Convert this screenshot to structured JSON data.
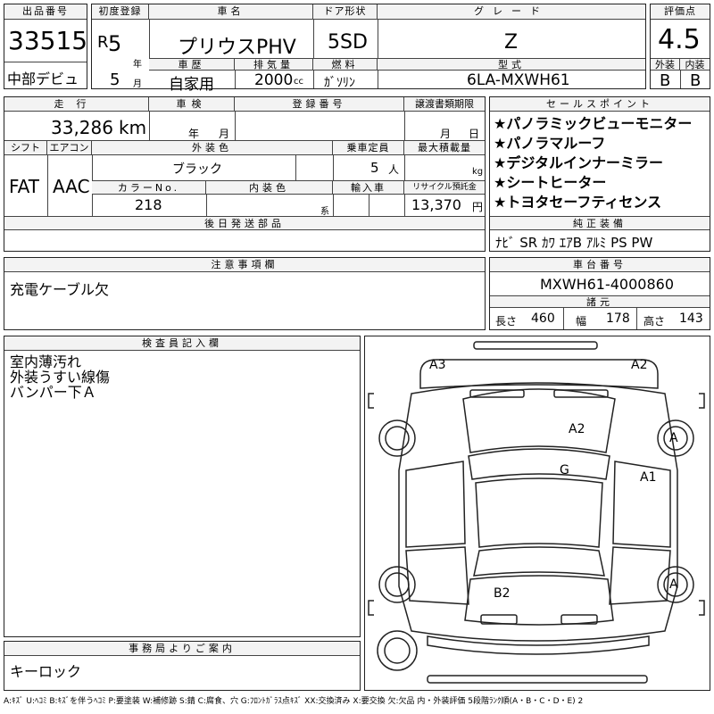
{
  "header": {
    "lot_label": "出品番号",
    "lot_number": "33515",
    "venue": "中部デビュ",
    "first_reg_label": "初度登録",
    "era": "R",
    "year_num": "5",
    "year_unit": "年",
    "month_num": "5",
    "month_unit": "月",
    "car_name_label": "車名",
    "car_name": "プリウスPHV",
    "door_label": "ドア形状",
    "door": "5SD",
    "grade_label": "グレード",
    "grade": "Z",
    "score_label": "評価点",
    "score": "4.5",
    "history_label": "車歴",
    "history": "自家用",
    "displacement_label": "排気量",
    "displacement": "2000",
    "displacement_unit": "cc",
    "fuel_label": "燃料",
    "fuel": "ｶﾞｿﾘﾝ",
    "model_label": "型式",
    "model": "6LA-MXWH61",
    "ext_label": "外装",
    "ext": "B",
    "int_label": "内装",
    "int": "B"
  },
  "row2": {
    "mileage_label": "走行",
    "mileage": "33,286",
    "mileage_unit": "km",
    "inspection_label": "車検",
    "insp_year_unit": "年",
    "insp_month_unit": "月",
    "reg_label": "登録番号",
    "transfer_label": "譲渡書類期限",
    "transfer_month": "月",
    "transfer_day": "日",
    "shift_label": "シフト",
    "shift": "FAT",
    "ac_label": "エアコン",
    "ac": "AAC",
    "color_label": "外装色",
    "color": "ブラック",
    "capacity_label": "乗車定員",
    "capacity": "5",
    "capacity_unit": "人",
    "load_label": "最大積載量",
    "load_unit": "kg",
    "color_no_label": "カラーNo.",
    "color_no": "218",
    "int_color_label": "内装色",
    "int_color_suffix": "系",
    "import_label": "輸入車",
    "recycle_label": "リサイクル預託金",
    "recycle": "13,370",
    "recycle_unit": "円",
    "later_label": "後日発送部品"
  },
  "sales": {
    "label": "セールスポイント",
    "points": [
      "★パノラミックビューモニター",
      "★パノラマルーフ",
      "★デジタルインナーミラー",
      "★シートヒーター",
      "★トヨタセーフティセンス"
    ],
    "equip_label": "純正装備",
    "equip": "ﾅﾋﾞ SR ｶﾜ ｴｱB ｱﾙﾐ PS PW"
  },
  "notes": {
    "label": "注意事項欄",
    "text": "充電ケーブル欠"
  },
  "chassis": {
    "label": "車台番号",
    "number": "MXWH61-4000860",
    "dims_label": "諸元",
    "length_label": "長さ",
    "length": "460",
    "width_label": "幅",
    "width": "178",
    "height_label": "高さ",
    "height": "143"
  },
  "inspector": {
    "label": "検査員記入欄",
    "lines": [
      "室内薄汚れ",
      "外装うすい線傷",
      "バンパー下Ａ"
    ]
  },
  "office": {
    "label": "事務局よりご案内",
    "text": "キーロック"
  },
  "diagram": {
    "marks": {
      "a3": "A3",
      "a2_top": "A2",
      "a2_roof": "A2",
      "g": "G",
      "a1": "A1",
      "a_front_tire": "A",
      "a_rear_tire": "A",
      "b2": "B2"
    }
  },
  "footer": {
    "legend": "A:ｷｽﾞ U:ﾍｺﾐ B:ｷｽﾞを伴うﾍｺﾐ P:要塗装 W:補修跡 S:錆 C:腐食、穴 G:ﾌﾛﾝﾄｶﾞﾗｽ点ｷｽﾞ XX:交換済み X:要交換 欠:欠品 内・外装評価 5段階ﾗﾝｸ順(A・B・C・D・E) 2"
  }
}
